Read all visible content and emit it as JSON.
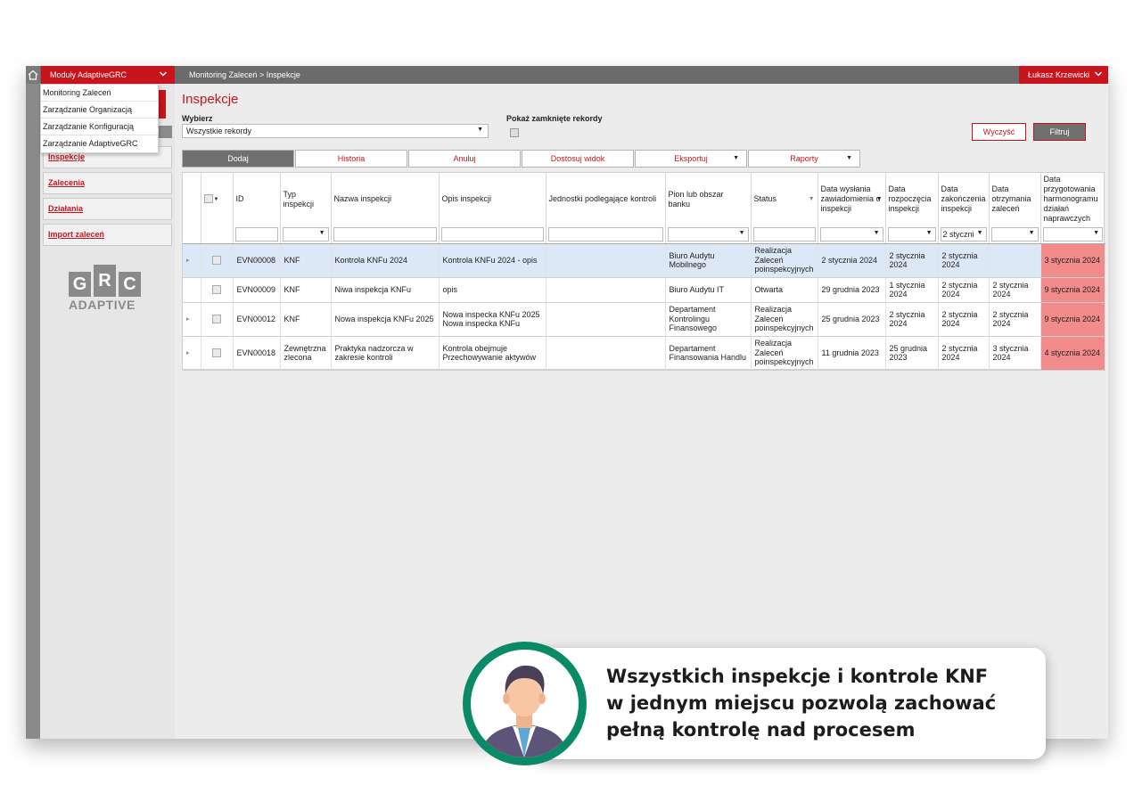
{
  "topbar": {
    "modules_label": "Moduły AdaptiveGRC",
    "breadcrumb": "Monitoring Zaleceń > Inspekcje",
    "user_name": "Łukasz Krzewicki"
  },
  "modules_menu": [
    "Monitoring Zaleceń",
    "Zarządzanie Organizacją",
    "Zarządzanie Konfiguracją",
    "Zarządzanie AdaptiveGRC"
  ],
  "sidebar": {
    "items": [
      "Inspekcje",
      "Zalecenia",
      "Działania",
      "Import zaleceń"
    ],
    "logo_letters": [
      "G",
      "R",
      "C"
    ],
    "logo_text": "ADAPTIVE"
  },
  "page": {
    "title": "Inspekcje",
    "select_label": "Wybierz",
    "select_value": "Wszystkie rekordy",
    "closed_label": "Pokaż zamknięte rekordy",
    "clear_button": "Wyczyść",
    "filter_button": "Filtruj"
  },
  "tabs": [
    "Dodaj",
    "Historia",
    "Anuluj",
    "Dostosuj widok",
    "Eksportuj",
    "Raporty"
  ],
  "table": {
    "headers": [
      "ID",
      "Typ inspekcji",
      "Nazwa inspekcji",
      "Opis inspekcji",
      "Jednostki podlegające kontroli",
      "Pion lub obszar banku",
      "Status",
      "Data wysłania zawiadomienia o inspekcji",
      "Data rozpoczęcia inspekcji",
      "Data zakończenia inspekcji",
      "Data otrzymania zaleceń",
      "Data przygotowania harmonogramu działań naprawczych"
    ],
    "filter_value_end": "2 styczni",
    "rows": [
      {
        "id": "EVN00008",
        "type": "KNF",
        "name": "Kontrola KNFu 2024",
        "desc": "Kontrola KNFu 2024 - opis",
        "units": "",
        "pion": "Biuro Audytu Mobilnego",
        "status": "Realizacja Zaleceń poinspekcyjnych",
        "sent": "2 stycznia 2024",
        "start": "2 stycznia 2024",
        "end": "2 stycznia 2024",
        "recv": "",
        "plan": "3 stycznia 2024"
      },
      {
        "id": "EVN00009",
        "type": "KNF",
        "name": "Niwa inspekcja KNFu",
        "desc": "opis",
        "units": "",
        "pion": "Biuro Audytu IT",
        "status": "Otwarta",
        "sent": "29 grudnia 2023",
        "start": "1 stycznia 2024",
        "end": "2 stycznia 2024",
        "recv": "2 stycznia 2024",
        "plan": "9 stycznia 2024"
      },
      {
        "id": "EVN00012",
        "type": "KNF",
        "name": "Nowa inspekcja KNFu 2025",
        "desc": "Nowa inspecka KNFu 2025 Nowa inspecka KNFu",
        "units": "",
        "pion": "Departament Kontrolingu Finansowego",
        "status": "Realizacja Zaleceń poinspekcyjnych",
        "sent": "25 grudnia 2023",
        "start": "2 stycznia 2024",
        "end": "2 stycznia 2024",
        "recv": "2 stycznia 2024",
        "plan": "9 stycznia 2024"
      },
      {
        "id": "EVN00018",
        "type": "Zewnętrzna zlecona",
        "name": "Praktyka nadzorcza w zakresie kontroli",
        "desc": "Kontrola obejmuje Przechowywanie aktywów",
        "units": "",
        "pion": "Departament Finansowania Handlu",
        "status": "Realizacja Zaleceń poinspekcyjnych",
        "sent": "11 grudnia 2023",
        "start": "25 grudnia 2023",
        "end": "2 stycznia 2024",
        "recv": "3 stycznia 2024",
        "plan": "4 stycznia 2024"
      }
    ]
  },
  "callout": {
    "line1": "Wszystkich inspekcje i kontrole KNF",
    "line2": "w jednym miejscu pozwolą zachować",
    "line3": "pełną kontrolę nad procesem"
  },
  "colors": {
    "brand_red": "#c8141c",
    "topbar_gray": "#6b6b6b",
    "late_highlight": "#f28b8b",
    "selected_row": "#dde8f7",
    "avatar_ring": "#0a8a67"
  }
}
